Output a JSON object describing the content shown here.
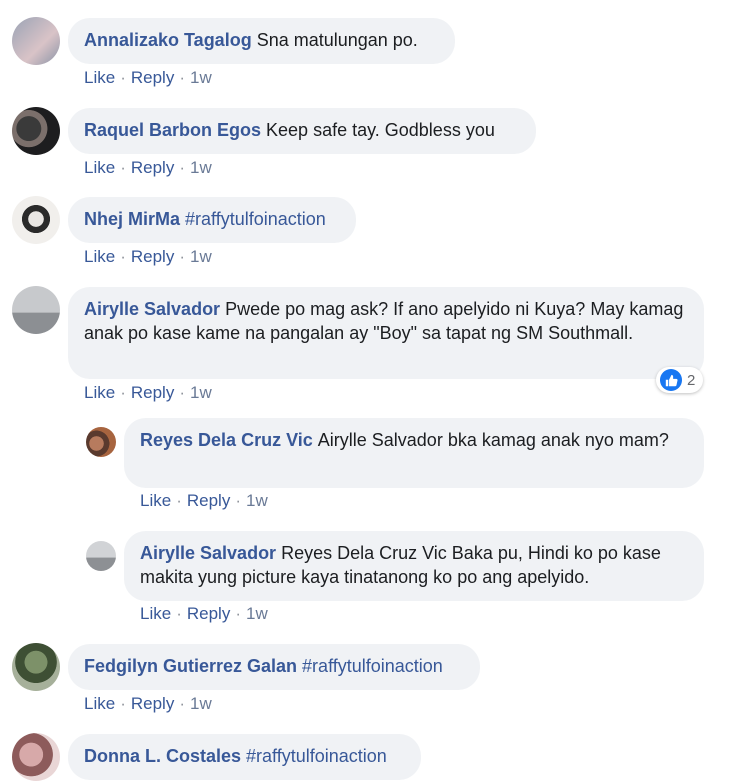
{
  "actions": {
    "like": "Like",
    "reply": "Reply",
    "sep": "·"
  },
  "comments": [
    {
      "author": "Annalizako Tagalog",
      "text": "Sna matulungan po.",
      "time": "1w"
    },
    {
      "author": "Raquel Barbon Egos",
      "text": "Keep safe tay. Godbless you",
      "time": "1w"
    },
    {
      "author": "Nhej MirMa",
      "text": "#raffytulfoinaction",
      "time": "1w"
    },
    {
      "author": "Airylle Salvador",
      "text": "Pwede po mag ask? If ano apelyido ni Kuya? May kamag anak po kase kame na pangalan ay \"Boy\" sa tapat ng SM Southmall.",
      "time": "1w",
      "reactions": "2"
    },
    {
      "author": "Reyes Dela Cruz Vic",
      "text": "Airylle Salvador bka kamag anak nyo mam?",
      "time": "1w"
    },
    {
      "author": "Airylle Salvador",
      "text": "Reyes Dela Cruz Vic Baka pu, Hindi ko po kase makita yung picture kaya tinatanong ko po ang apelyido.",
      "time": "1w"
    },
    {
      "author": "Fedgilyn Gutierrez Galan",
      "text": "#raffytulfoinaction",
      "time": "1w"
    },
    {
      "author": "Donna L. Costales",
      "text": "#raffytulfoinaction"
    }
  ]
}
